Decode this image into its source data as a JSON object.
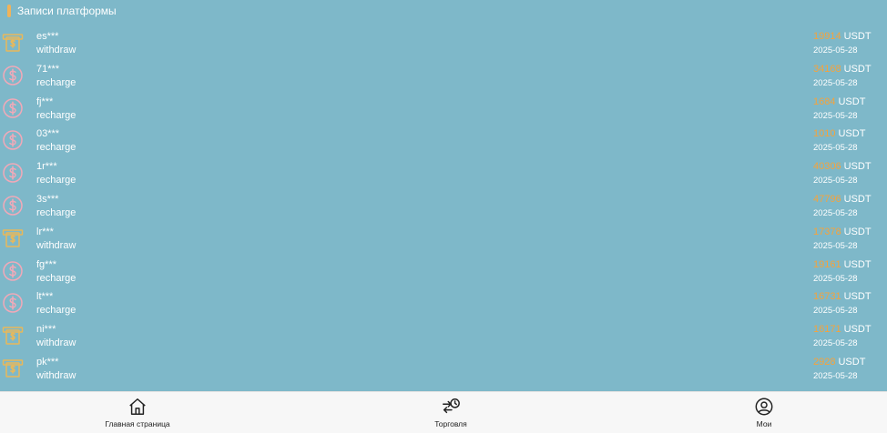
{
  "header": {
    "title": "Записи платформы"
  },
  "colors": {
    "background": "#7eb8c9",
    "accent": "#f5a33c",
    "recharge_icon": "#f2a9b8",
    "withdraw_icon": "#e8b85a",
    "tabbar": "#f7f7f7"
  },
  "records": [
    {
      "user": "es***",
      "type": "withdraw",
      "icon": "atm-card-icon",
      "amount": "19914",
      "currency": "USDT",
      "date": "2025-05-28"
    },
    {
      "user": "71***",
      "type": "recharge",
      "icon": "dollar-circle-icon",
      "amount": "34168",
      "currency": "USDT",
      "date": "2025-05-28"
    },
    {
      "user": "fj***",
      "type": "recharge",
      "icon": "dollar-circle-icon",
      "amount": "1684",
      "currency": "USDT",
      "date": "2025-05-28"
    },
    {
      "user": "03***",
      "type": "recharge",
      "icon": "dollar-circle-icon",
      "amount": "1010",
      "currency": "USDT",
      "date": "2025-05-28"
    },
    {
      "user": "1r***",
      "type": "recharge",
      "icon": "dollar-circle-icon",
      "amount": "40306",
      "currency": "USDT",
      "date": "2025-05-28"
    },
    {
      "user": "3s***",
      "type": "recharge",
      "icon": "dollar-circle-icon",
      "amount": "47796",
      "currency": "USDT",
      "date": "2025-05-28"
    },
    {
      "user": "lr***",
      "type": "withdraw",
      "icon": "atm-card-icon",
      "amount": "17378",
      "currency": "USDT",
      "date": "2025-05-28"
    },
    {
      "user": "fg***",
      "type": "recharge",
      "icon": "dollar-circle-icon",
      "amount": "19161",
      "currency": "USDT",
      "date": "2025-05-28"
    },
    {
      "user": "lt***",
      "type": "recharge",
      "icon": "dollar-circle-icon",
      "amount": "16731",
      "currency": "USDT",
      "date": "2025-05-28"
    },
    {
      "user": "ni***",
      "type": "withdraw",
      "icon": "atm-card-icon",
      "amount": "16171",
      "currency": "USDT",
      "date": "2025-05-28"
    },
    {
      "user": "pk***",
      "type": "withdraw",
      "icon": "atm-card-icon",
      "amount": "2928",
      "currency": "USDT",
      "date": "2025-05-28"
    }
  ],
  "tabbar": {
    "home": {
      "label": "Главная страница",
      "icon": "home-icon"
    },
    "trade": {
      "label": "Торговля",
      "icon": "trade-exchange-icon"
    },
    "mine": {
      "label": "Мои",
      "icon": "user-circle-icon"
    }
  }
}
